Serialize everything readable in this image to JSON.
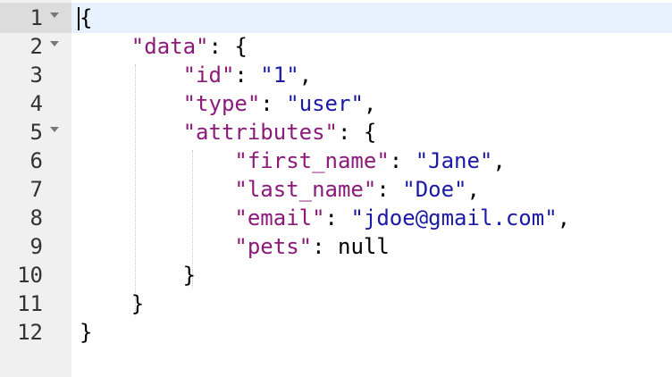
{
  "lines": [
    {
      "num": "1",
      "parts": [
        {
          "t": "pun",
          "v": "{"
        }
      ]
    },
    {
      "num": "2",
      "parts": [
        {
          "t": "pun",
          "v": "    "
        },
        {
          "t": "key",
          "v": "\"data\""
        },
        {
          "t": "pun",
          "v": ": {"
        }
      ]
    },
    {
      "num": "3",
      "parts": [
        {
          "t": "pun",
          "v": "        "
        },
        {
          "t": "key",
          "v": "\"id\""
        },
        {
          "t": "pun",
          "v": ": "
        },
        {
          "t": "str",
          "v": "\"1\""
        },
        {
          "t": "pun",
          "v": ","
        }
      ]
    },
    {
      "num": "4",
      "parts": [
        {
          "t": "pun",
          "v": "        "
        },
        {
          "t": "key",
          "v": "\"type\""
        },
        {
          "t": "pun",
          "v": ": "
        },
        {
          "t": "str",
          "v": "\"user\""
        },
        {
          "t": "pun",
          "v": ","
        }
      ]
    },
    {
      "num": "5",
      "parts": [
        {
          "t": "pun",
          "v": "        "
        },
        {
          "t": "key",
          "v": "\"attributes\""
        },
        {
          "t": "pun",
          "v": ": {"
        }
      ]
    },
    {
      "num": "6",
      "parts": [
        {
          "t": "pun",
          "v": "            "
        },
        {
          "t": "key",
          "v": "\"first_name\""
        },
        {
          "t": "pun",
          "v": ": "
        },
        {
          "t": "str",
          "v": "\"Jane\""
        },
        {
          "t": "pun",
          "v": ","
        }
      ]
    },
    {
      "num": "7",
      "parts": [
        {
          "t": "pun",
          "v": "            "
        },
        {
          "t": "key",
          "v": "\"last_name\""
        },
        {
          "t": "pun",
          "v": ": "
        },
        {
          "t": "str",
          "v": "\"Doe\""
        },
        {
          "t": "pun",
          "v": ","
        }
      ]
    },
    {
      "num": "8",
      "parts": [
        {
          "t": "pun",
          "v": "            "
        },
        {
          "t": "key",
          "v": "\"email\""
        },
        {
          "t": "pun",
          "v": ": "
        },
        {
          "t": "str",
          "v": "\"jdoe@gmail.com\""
        },
        {
          "t": "pun",
          "v": ","
        }
      ]
    },
    {
      "num": "9",
      "parts": [
        {
          "t": "pun",
          "v": "            "
        },
        {
          "t": "key",
          "v": "\"pets\""
        },
        {
          "t": "pun",
          "v": ": "
        },
        {
          "t": "lit",
          "v": "null"
        }
      ]
    },
    {
      "num": "10",
      "parts": [
        {
          "t": "pun",
          "v": "        }"
        }
      ]
    },
    {
      "num": "11",
      "parts": [
        {
          "t": "pun",
          "v": "    }"
        }
      ]
    },
    {
      "num": "12",
      "parts": [
        {
          "t": "pun",
          "v": "}"
        }
      ]
    }
  ],
  "foldable_lines": [
    "1",
    "2",
    "5"
  ],
  "active_line": "1",
  "colors": {
    "key": "#8b1a7a",
    "string": "#1a1aa6",
    "punctuation": "#000000",
    "gutter_bg": "#f0f0f0",
    "active_line_bg": "#e8f2fe"
  },
  "icons": {
    "fold": "fold-arrow-down-icon"
  }
}
